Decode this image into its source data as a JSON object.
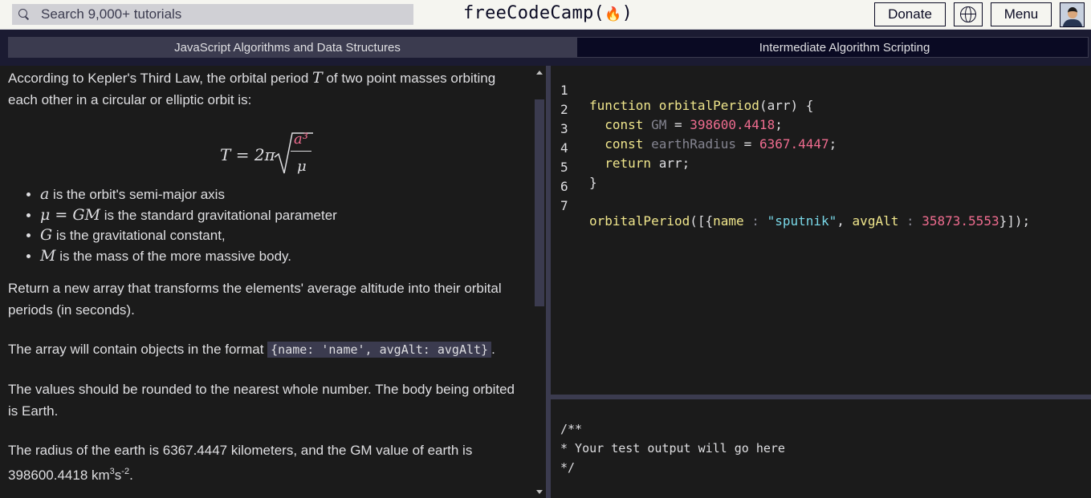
{
  "nav": {
    "search_placeholder": "Search 9,000+ tutorials",
    "logo_text": "freeCodeCamp(",
    "logo_flame": "🔥",
    "logo_close": ")",
    "donate_label": "Donate",
    "menu_label": "Menu"
  },
  "breadcrumb": {
    "superblock": "JavaScript Algorithms and Data Structures",
    "block": "Intermediate Algorithm Scripting"
  },
  "instructions": {
    "intro_a": "According to Kepler's Third Law, the orbital period ",
    "intro_var": "T",
    "intro_b": " of two point masses orbiting each other in a circular or elliptic orbit is:",
    "formula_lhs": "T = 2π",
    "formula_num": "a³",
    "formula_den": "μ",
    "bullets": [
      {
        "var": "a",
        "text": " is the orbit's semi-major axis"
      },
      {
        "var": "μ = GM",
        "text": " is the standard gravitational parameter"
      },
      {
        "var": "G",
        "text": " is the gravitational constant,"
      },
      {
        "var": "M",
        "text": " is the mass of the more massive body."
      }
    ],
    "p_return": "Return a new array that transforms the elements' average altitude into their orbital periods (in seconds).",
    "p_format_a": "The array will contain objects in the format ",
    "p_format_code": "{name: 'name', avgAlt: avgAlt}",
    "p_format_b": ".",
    "p_round": "The values should be rounded to the nearest whole number. The body being orbited is Earth.",
    "p_radius_a": "The radius of the earth is 6367.4447 kilometers, and the GM value of earth is 398600.4418 km",
    "p_radius_sup1": "3",
    "p_radius_s": "s",
    "p_radius_sup2": "-2",
    "p_radius_end": "."
  },
  "editor": {
    "line_numbers": [
      "1",
      "2",
      "3",
      "4",
      "5",
      "6",
      "7"
    ],
    "l1": {
      "kw": "function ",
      "fn": "orbitalPeriod",
      "rest": "(arr) {"
    },
    "l2": {
      "kw": "  const ",
      "name": "GM",
      "eq": " = ",
      "num": "398600.4418",
      "end": ";"
    },
    "l3": {
      "kw": "  const ",
      "name": "earthRadius",
      "eq": " = ",
      "num": "6367.4447",
      "end": ";"
    },
    "l4": {
      "kw": "  return ",
      "rest": "arr;"
    },
    "l5": {
      "rest": "}"
    },
    "l7": {
      "fn": "orbitalPeriod",
      "open": "([{",
      "k1": "name",
      "sep1": " : ",
      "s1": "\"sputnik\"",
      "comma": ", ",
      "k2": "avgAlt",
      "sep2": " : ",
      "n2": "35873.5553",
      "close": "}]);"
    }
  },
  "output": {
    "line1": "/**",
    "line2": "* Your test output will go here",
    "line3": "*/"
  }
}
